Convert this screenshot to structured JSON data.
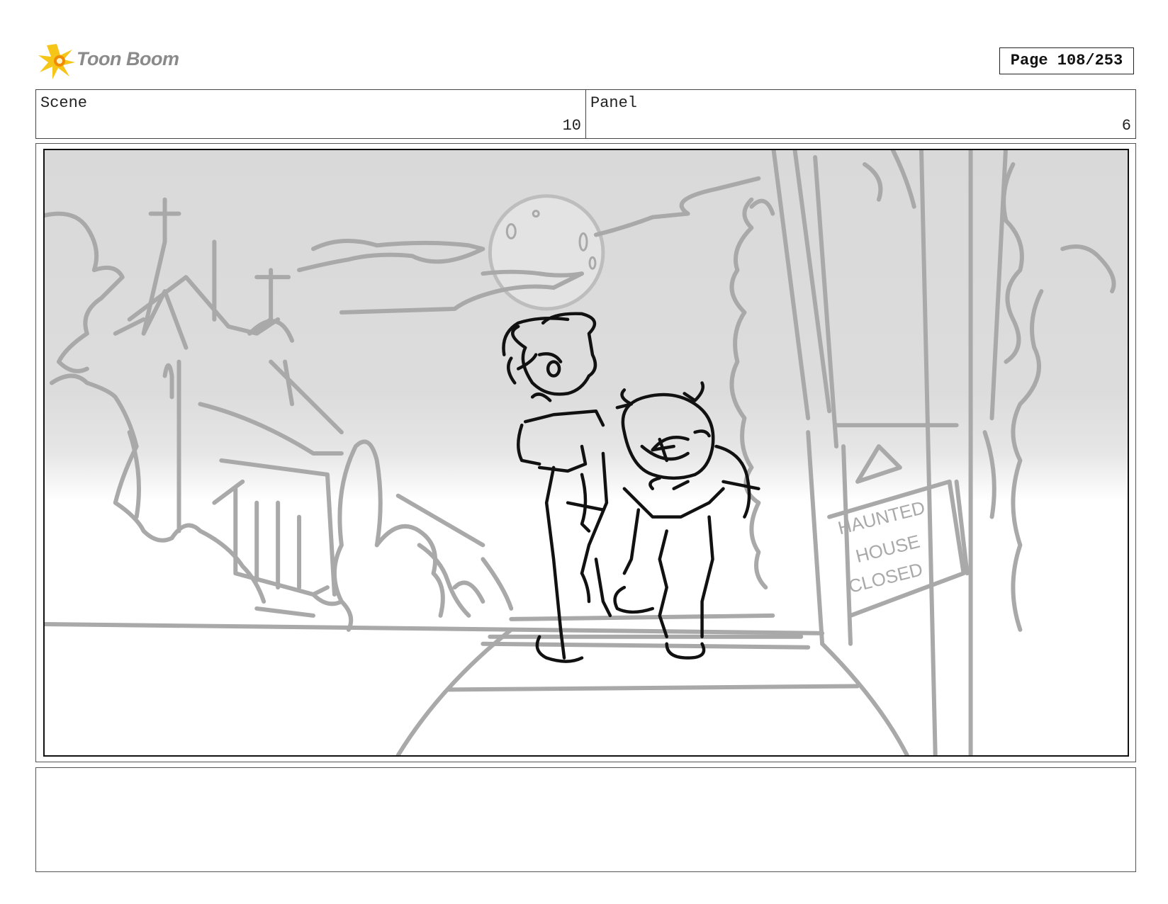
{
  "header": {
    "logo_text": "Toon Boom",
    "page_label": "Page 108/253"
  },
  "info": {
    "scene_label": "Scene",
    "scene_value": "10",
    "panel_label": "Panel",
    "panel_value": "6"
  },
  "drawing": {
    "sign_text": "HAUNTED HOUSE CLOSED"
  },
  "notes": {
    "text": ""
  }
}
